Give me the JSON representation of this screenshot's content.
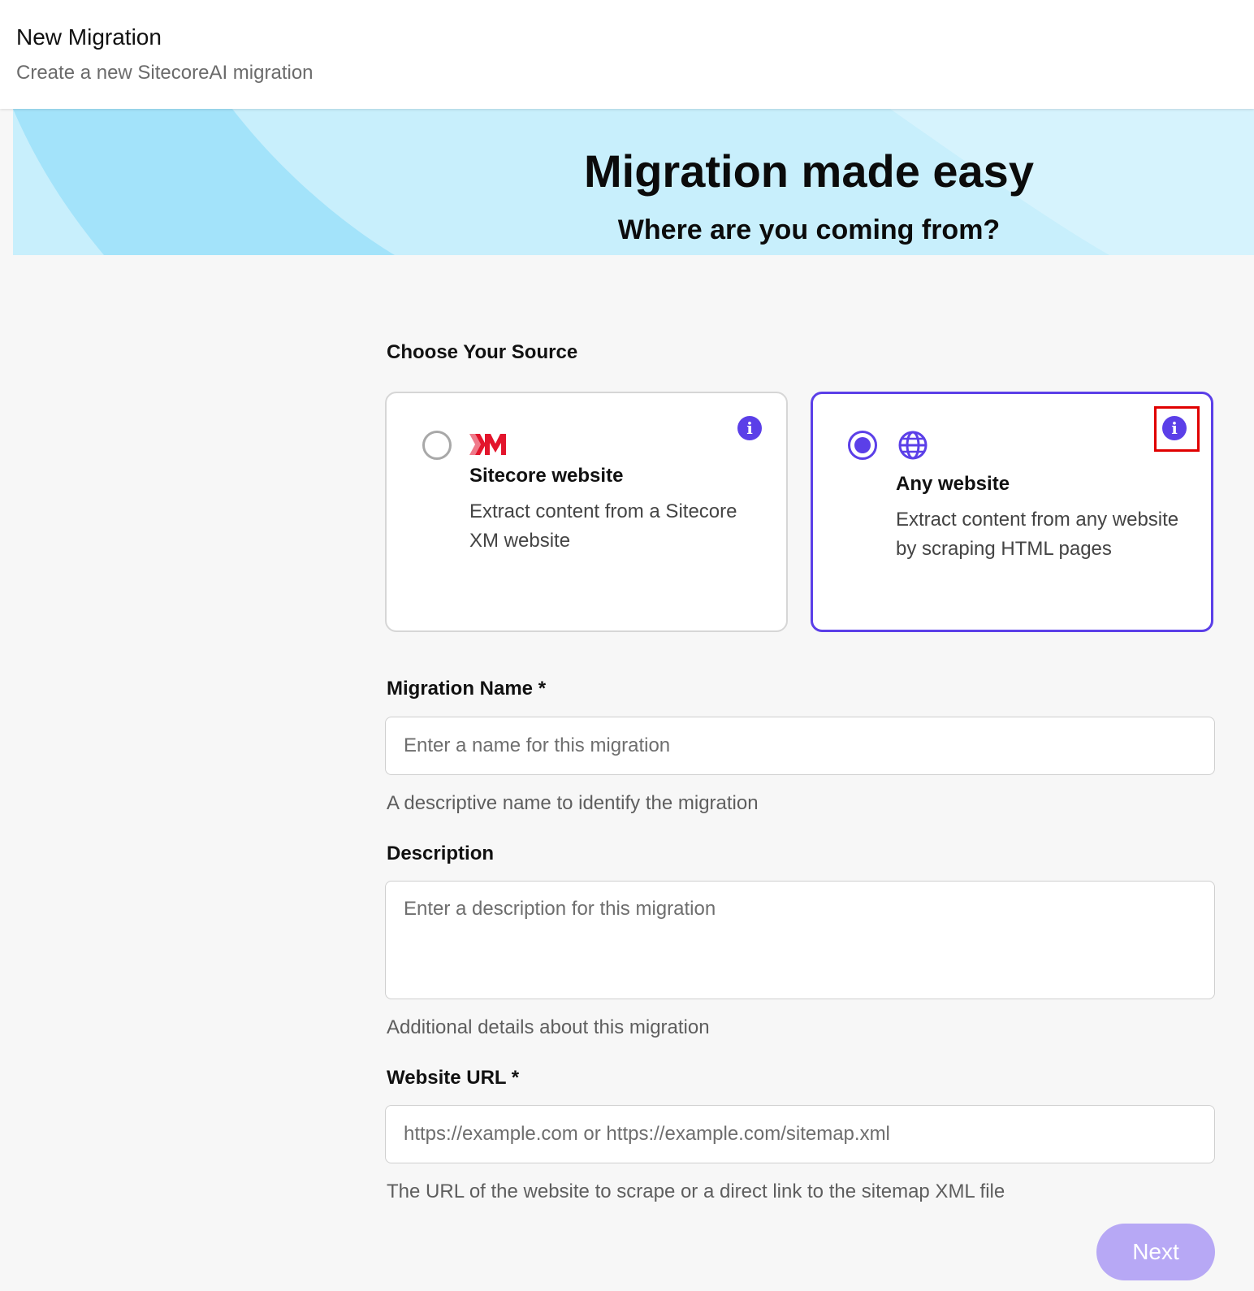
{
  "header": {
    "title": "New Migration",
    "subtitle": "Create a new SitecoreAI migration"
  },
  "banner": {
    "headline": "Migration made easy",
    "subheadline": "Where are you coming from?"
  },
  "source": {
    "label": "Choose Your Source",
    "options": [
      {
        "title": "Sitecore website",
        "description": "Extract content from a Sitecore XM website",
        "logo_text": "XM",
        "icon": "xm-logo-icon",
        "selected": false,
        "info_glyph": "i"
      },
      {
        "title": "Any website",
        "description": "Extract content from any website by scraping HTML pages",
        "icon": "globe-icon",
        "selected": true,
        "info_glyph": "i"
      }
    ]
  },
  "form": {
    "name": {
      "label": "Migration Name *",
      "placeholder": "Enter a name for this migration",
      "value": "",
      "help": "A descriptive name to identify the migration"
    },
    "description": {
      "label": "Description",
      "placeholder": "Enter a description for this migration",
      "value": "",
      "help": "Additional details about this migration"
    },
    "url": {
      "label": "Website URL *",
      "placeholder": "https://example.com or https://example.com/sitemap.xml",
      "value": "",
      "help": "The URL of the website to scrape or a direct link to the sitemap XML file"
    }
  },
  "actions": {
    "next_label": "Next"
  },
  "colors": {
    "accent": "#5b3fe8",
    "next_disabled": "#b7a8f5",
    "banner_light": "#c8effc",
    "banner_mid": "#a3e3fa",
    "xm_red": "#e3152c",
    "highlight": "#e00000"
  }
}
